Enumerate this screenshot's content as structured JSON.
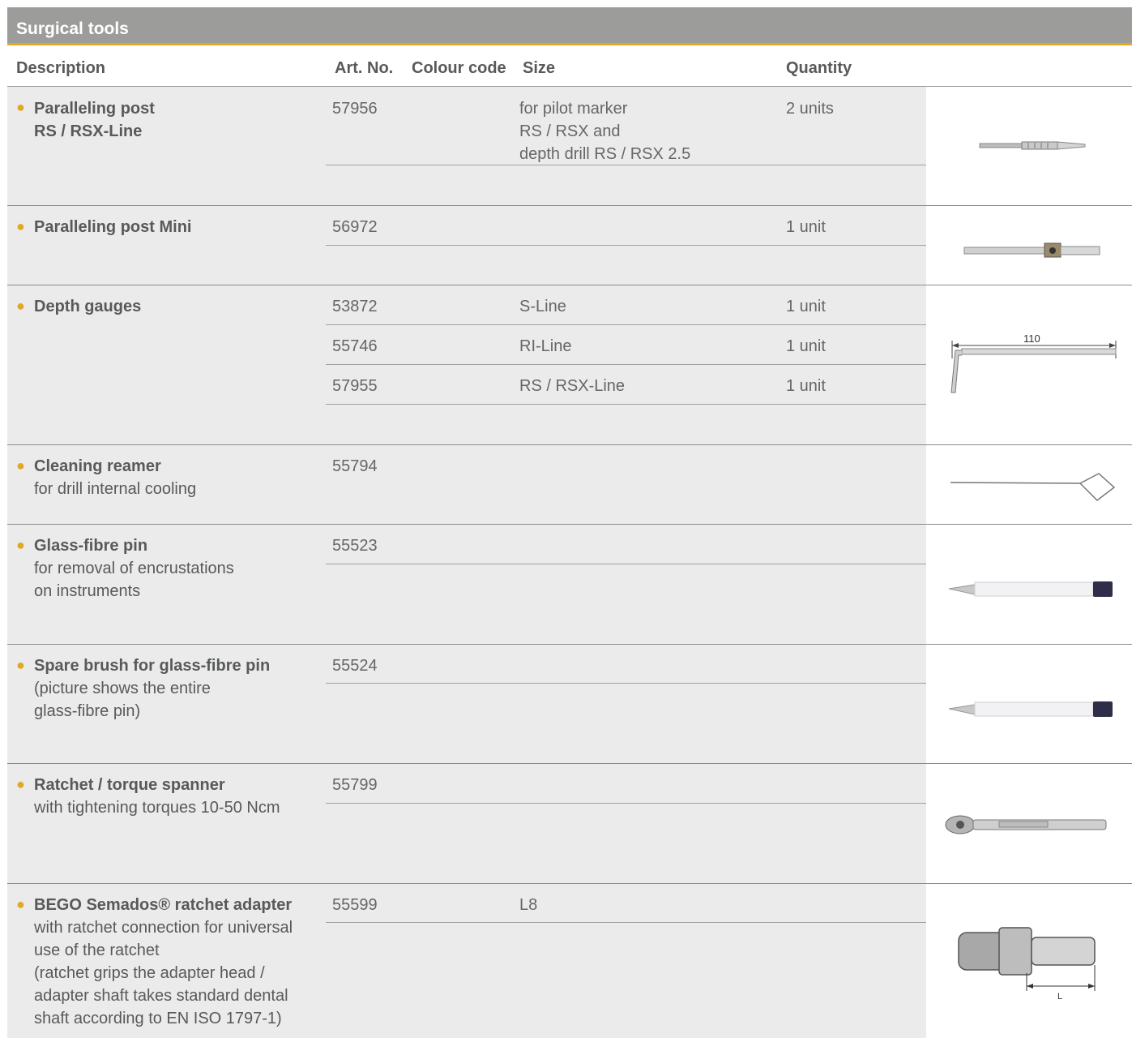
{
  "title": "Surgical tools",
  "headers": {
    "description": "Description",
    "art_no": "Art. No.",
    "colour_code": "Colour code",
    "size": "Size",
    "quantity": "Quantity"
  },
  "rows": [
    {
      "name": [
        "Paralleling post",
        "RS / RSX-Line"
      ],
      "note": [],
      "art_no": "57956",
      "size": [
        "for pilot marker",
        "RS / RSX and",
        "depth drill RS / RSX 2.5"
      ],
      "quantity": "2 units",
      "image": "paralleling-post-image"
    },
    {
      "name": [
        "Paralleling post Mini"
      ],
      "note": [],
      "art_no": "56972",
      "size": [],
      "quantity": "1 unit",
      "image": "paralleling-post-mini-image"
    },
    {
      "name": [
        "Depth gauges"
      ],
      "note": [],
      "sub": [
        {
          "art_no": "53872",
          "size": "S-Line",
          "quantity": "1 unit"
        },
        {
          "art_no": "55746",
          "size": "RI-Line",
          "quantity": "1 unit"
        },
        {
          "art_no": "57955",
          "size": "RS / RSX-Line",
          "quantity": "1 unit"
        }
      ],
      "dimension_label": "110",
      "image": "depth-gauge-image"
    },
    {
      "name": [
        "Cleaning reamer"
      ],
      "note": [
        "for drill internal cooling"
      ],
      "art_no": "55794",
      "image": "cleaning-reamer-image"
    },
    {
      "name": [
        "Glass-fibre pin"
      ],
      "note": [
        "for removal of encrustations",
        "on instruments"
      ],
      "art_no": "55523",
      "image": "glass-fibre-pin-image"
    },
    {
      "name": [
        "Spare brush for glass-fibre pin"
      ],
      "note": [
        "(picture shows the entire",
        "glass-fibre pin)"
      ],
      "art_no": "55524",
      "image": "spare-brush-image"
    },
    {
      "name": [
        "Ratchet / torque spanner"
      ],
      "note": [
        "with tightening torques 10-50 Ncm"
      ],
      "art_no": "55799",
      "image": "ratchet-image"
    },
    {
      "name": [
        "BEGO Semados® ratchet adapter"
      ],
      "note": [
        "with ratchet connection for universal",
        "use of the ratchet",
        "(ratchet grips the adapter head /",
        "adapter shaft takes standard dental",
        "shaft according to EN ISO 1797-1)"
      ],
      "art_no": "55599",
      "size": [
        "L8"
      ],
      "dimension_label": "L",
      "image": "ratchet-adapter-image"
    }
  ],
  "colors": {
    "accent": "#e0a823",
    "title_bg": "#9c9c9b",
    "row_bg": "#ebebeb"
  }
}
